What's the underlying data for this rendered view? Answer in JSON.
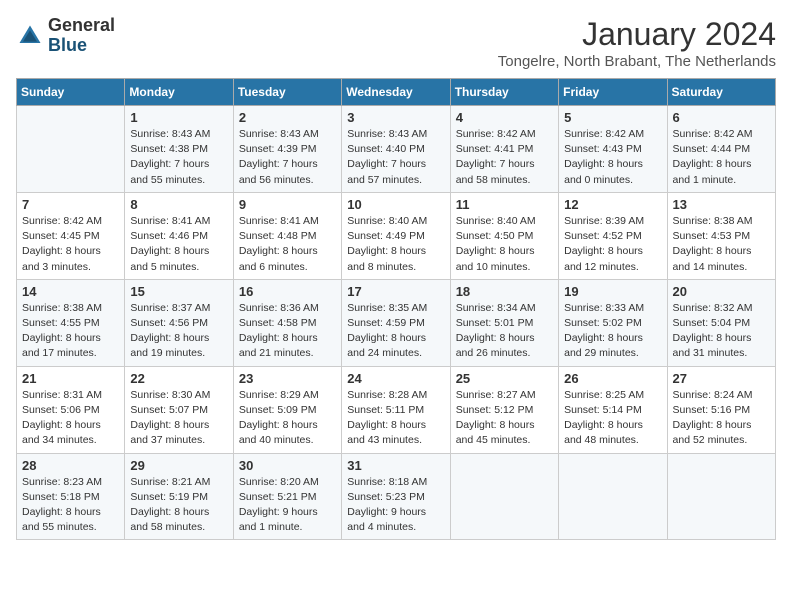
{
  "header": {
    "logo_general": "General",
    "logo_blue": "Blue",
    "title": "January 2024",
    "location": "Tongelre, North Brabant, The Netherlands"
  },
  "days_of_week": [
    "Sunday",
    "Monday",
    "Tuesday",
    "Wednesday",
    "Thursday",
    "Friday",
    "Saturday"
  ],
  "weeks": [
    [
      {
        "day": "",
        "sunrise": "",
        "sunset": "",
        "daylight": ""
      },
      {
        "day": "1",
        "sunrise": "Sunrise: 8:43 AM",
        "sunset": "Sunset: 4:38 PM",
        "daylight": "Daylight: 7 hours and 55 minutes."
      },
      {
        "day": "2",
        "sunrise": "Sunrise: 8:43 AM",
        "sunset": "Sunset: 4:39 PM",
        "daylight": "Daylight: 7 hours and 56 minutes."
      },
      {
        "day": "3",
        "sunrise": "Sunrise: 8:43 AM",
        "sunset": "Sunset: 4:40 PM",
        "daylight": "Daylight: 7 hours and 57 minutes."
      },
      {
        "day": "4",
        "sunrise": "Sunrise: 8:42 AM",
        "sunset": "Sunset: 4:41 PM",
        "daylight": "Daylight: 7 hours and 58 minutes."
      },
      {
        "day": "5",
        "sunrise": "Sunrise: 8:42 AM",
        "sunset": "Sunset: 4:43 PM",
        "daylight": "Daylight: 8 hours and 0 minutes."
      },
      {
        "day": "6",
        "sunrise": "Sunrise: 8:42 AM",
        "sunset": "Sunset: 4:44 PM",
        "daylight": "Daylight: 8 hours and 1 minute."
      }
    ],
    [
      {
        "day": "7",
        "sunrise": "Sunrise: 8:42 AM",
        "sunset": "Sunset: 4:45 PM",
        "daylight": "Daylight: 8 hours and 3 minutes."
      },
      {
        "day": "8",
        "sunrise": "Sunrise: 8:41 AM",
        "sunset": "Sunset: 4:46 PM",
        "daylight": "Daylight: 8 hours and 5 minutes."
      },
      {
        "day": "9",
        "sunrise": "Sunrise: 8:41 AM",
        "sunset": "Sunset: 4:48 PM",
        "daylight": "Daylight: 8 hours and 6 minutes."
      },
      {
        "day": "10",
        "sunrise": "Sunrise: 8:40 AM",
        "sunset": "Sunset: 4:49 PM",
        "daylight": "Daylight: 8 hours and 8 minutes."
      },
      {
        "day": "11",
        "sunrise": "Sunrise: 8:40 AM",
        "sunset": "Sunset: 4:50 PM",
        "daylight": "Daylight: 8 hours and 10 minutes."
      },
      {
        "day": "12",
        "sunrise": "Sunrise: 8:39 AM",
        "sunset": "Sunset: 4:52 PM",
        "daylight": "Daylight: 8 hours and 12 minutes."
      },
      {
        "day": "13",
        "sunrise": "Sunrise: 8:38 AM",
        "sunset": "Sunset: 4:53 PM",
        "daylight": "Daylight: 8 hours and 14 minutes."
      }
    ],
    [
      {
        "day": "14",
        "sunrise": "Sunrise: 8:38 AM",
        "sunset": "Sunset: 4:55 PM",
        "daylight": "Daylight: 8 hours and 17 minutes."
      },
      {
        "day": "15",
        "sunrise": "Sunrise: 8:37 AM",
        "sunset": "Sunset: 4:56 PM",
        "daylight": "Daylight: 8 hours and 19 minutes."
      },
      {
        "day": "16",
        "sunrise": "Sunrise: 8:36 AM",
        "sunset": "Sunset: 4:58 PM",
        "daylight": "Daylight: 8 hours and 21 minutes."
      },
      {
        "day": "17",
        "sunrise": "Sunrise: 8:35 AM",
        "sunset": "Sunset: 4:59 PM",
        "daylight": "Daylight: 8 hours and 24 minutes."
      },
      {
        "day": "18",
        "sunrise": "Sunrise: 8:34 AM",
        "sunset": "Sunset: 5:01 PM",
        "daylight": "Daylight: 8 hours and 26 minutes."
      },
      {
        "day": "19",
        "sunrise": "Sunrise: 8:33 AM",
        "sunset": "Sunset: 5:02 PM",
        "daylight": "Daylight: 8 hours and 29 minutes."
      },
      {
        "day": "20",
        "sunrise": "Sunrise: 8:32 AM",
        "sunset": "Sunset: 5:04 PM",
        "daylight": "Daylight: 8 hours and 31 minutes."
      }
    ],
    [
      {
        "day": "21",
        "sunrise": "Sunrise: 8:31 AM",
        "sunset": "Sunset: 5:06 PM",
        "daylight": "Daylight: 8 hours and 34 minutes."
      },
      {
        "day": "22",
        "sunrise": "Sunrise: 8:30 AM",
        "sunset": "Sunset: 5:07 PM",
        "daylight": "Daylight: 8 hours and 37 minutes."
      },
      {
        "day": "23",
        "sunrise": "Sunrise: 8:29 AM",
        "sunset": "Sunset: 5:09 PM",
        "daylight": "Daylight: 8 hours and 40 minutes."
      },
      {
        "day": "24",
        "sunrise": "Sunrise: 8:28 AM",
        "sunset": "Sunset: 5:11 PM",
        "daylight": "Daylight: 8 hours and 43 minutes."
      },
      {
        "day": "25",
        "sunrise": "Sunrise: 8:27 AM",
        "sunset": "Sunset: 5:12 PM",
        "daylight": "Daylight: 8 hours and 45 minutes."
      },
      {
        "day": "26",
        "sunrise": "Sunrise: 8:25 AM",
        "sunset": "Sunset: 5:14 PM",
        "daylight": "Daylight: 8 hours and 48 minutes."
      },
      {
        "day": "27",
        "sunrise": "Sunrise: 8:24 AM",
        "sunset": "Sunset: 5:16 PM",
        "daylight": "Daylight: 8 hours and 52 minutes."
      }
    ],
    [
      {
        "day": "28",
        "sunrise": "Sunrise: 8:23 AM",
        "sunset": "Sunset: 5:18 PM",
        "daylight": "Daylight: 8 hours and 55 minutes."
      },
      {
        "day": "29",
        "sunrise": "Sunrise: 8:21 AM",
        "sunset": "Sunset: 5:19 PM",
        "daylight": "Daylight: 8 hours and 58 minutes."
      },
      {
        "day": "30",
        "sunrise": "Sunrise: 8:20 AM",
        "sunset": "Sunset: 5:21 PM",
        "daylight": "Daylight: 9 hours and 1 minute."
      },
      {
        "day": "31",
        "sunrise": "Sunrise: 8:18 AM",
        "sunset": "Sunset: 5:23 PM",
        "daylight": "Daylight: 9 hours and 4 minutes."
      },
      {
        "day": "",
        "sunrise": "",
        "sunset": "",
        "daylight": ""
      },
      {
        "day": "",
        "sunrise": "",
        "sunset": "",
        "daylight": ""
      },
      {
        "day": "",
        "sunrise": "",
        "sunset": "",
        "daylight": ""
      }
    ]
  ]
}
